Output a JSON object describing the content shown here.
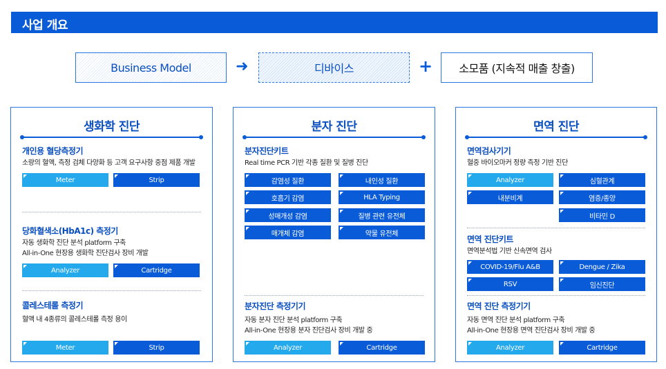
{
  "header": {
    "title": "사업 개요"
  },
  "flow": {
    "box1": "Business Model",
    "arrow": "➜",
    "box2": "디바이스",
    "plus": "+",
    "box3": "소모품 (지속적 매출 창출)"
  },
  "colors": {
    "primary": "#0a5bd8",
    "light_chip": "#24a9ec",
    "dark_chip": "#0a5bd8"
  },
  "panels": [
    {
      "title": "생화학 진단",
      "sections": [
        {
          "title": "개인용 혈당측정기",
          "desc": [
            "소량의 혈액, 측정 검체 다양화 등 고객 요구사항 중점 제품 개발"
          ],
          "chips": [
            "Meter",
            "Strip"
          ]
        },
        {
          "title": "당화혈색소(HbA1c) 측정기",
          "desc": [
            "자동 생화학 진단 분석 platform 구축",
            "All-in-One 현장용 생화학 진단검사 장비 개발"
          ],
          "chips": [
            "Analyzer",
            "Cartridge"
          ]
        },
        {
          "title": "콜레스테롤 측정기",
          "desc": [
            "혈액 내 4종류의 콜레스테롤 측정 용이"
          ],
          "chips": [
            "Meter",
            "Strip"
          ]
        }
      ]
    },
    {
      "title": "분자 진단",
      "sections": [
        {
          "title": "분자진단키트",
          "desc": [
            "Real time PCR 기반 각종 질환 및 질병 진단"
          ],
          "chips": [
            "감염성 질환",
            "내인성 질환",
            "호흡기 감염",
            "HLA Typing",
            "성매개성 감염",
            "질병 관련 유전체",
            "매개체 감염",
            "약물 유전체"
          ]
        },
        {
          "title": "분자진단 측정기기",
          "desc": [
            "자동 분자 진단 분석 platform 구축",
            "All-in-One 현장용 분자 진단검사 장비 개발 중"
          ],
          "chips": [
            "Analyzer",
            "Cartridge"
          ]
        }
      ]
    },
    {
      "title": "면역 진단",
      "sections": [
        {
          "title": "면역검사기기",
          "desc": [
            "혈중 바이오마커 정량 측정 기반 진단"
          ],
          "chips": [
            "Analyzer",
            "심혈관계",
            "내분비계",
            "염증/종양",
            "비타민 D"
          ]
        },
        {
          "title": "면역 진단키트",
          "desc": [
            "면역분석법 기반 신속면역 검사"
          ],
          "chips": [
            "COVID-19/Flu A&B",
            "Dengue / Zika",
            "RSV",
            "임신진단"
          ]
        },
        {
          "title": "면역 진단 측정기기",
          "desc": [
            "자동 면역 진단 분석 platform 구축",
            "All-in-One 현장용 면역 진단검사 장비 개발 중"
          ],
          "chips": [
            "Analyzer",
            "Cartridge"
          ]
        }
      ]
    }
  ]
}
